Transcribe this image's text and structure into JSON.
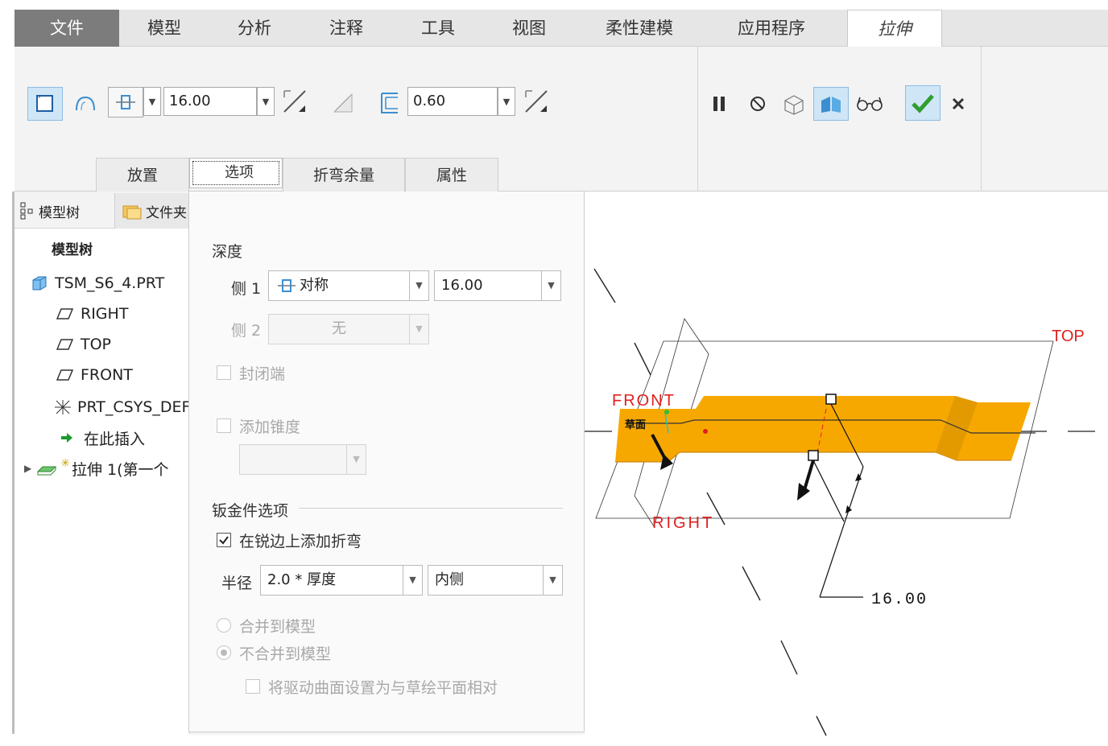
{
  "tabs": [
    "文件",
    "模型",
    "分析",
    "注释",
    "工具",
    "视图",
    "柔性建模",
    "应用程序",
    "拉伸"
  ],
  "toolbar": {
    "depth_value": "16.00",
    "thickness_value": "0.60"
  },
  "subtabs": [
    "放置",
    "选项",
    "折弯余量",
    "属性"
  ],
  "left_panel": {
    "tab_model_tree": "模型树",
    "tab_files": "文件夹",
    "header": "模型树",
    "items": [
      "TSM_S6_4.PRT",
      "RIGHT",
      "TOP",
      "FRONT",
      "PRT_CSYS_DEF",
      "在此插入",
      "拉伸 1(第一个"
    ]
  },
  "options": {
    "depth_title": "深度",
    "side1_label": "侧 1",
    "side1_type": "对称",
    "side1_value": "16.00",
    "side2_label": "侧 2",
    "side2_type": "无",
    "capped_ends": "封闭端",
    "add_taper": "添加锥度",
    "sheetmetal_title": "钣金件选项",
    "add_bends": "在锐边上添加折弯",
    "radius_label": "半径",
    "radius_value": "2.0 * 厚度",
    "radius_side": "内侧",
    "merge": "合并到模型",
    "no_merge": "不合并到模型",
    "driving_surface": "将驱动曲面设置为与草绘平面相对"
  },
  "viewport": {
    "label_top": "TOP",
    "label_front": "FRONT",
    "label_right": "RIGHT",
    "label_sketch": "草面",
    "dimension": "16.00"
  },
  "colors": {
    "file_tab": "#7c7c7c",
    "accent_blue": "#3b8fd1",
    "solid_orange": "#f7a800",
    "datum_red": "#e02020",
    "ok_green": "#2f9e2f"
  }
}
